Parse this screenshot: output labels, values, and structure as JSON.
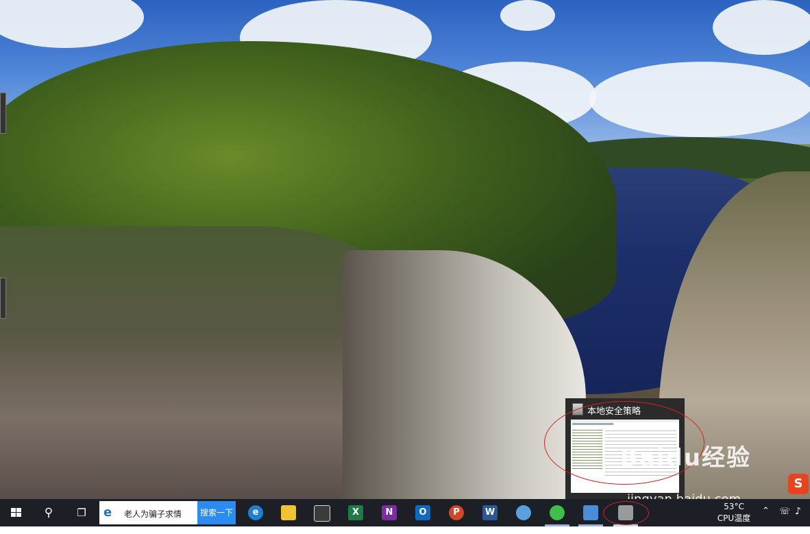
{
  "thumbnail": {
    "title": "本地安全策略"
  },
  "watermark": {
    "text": "Baidu经验",
    "url": "jingyan.baidu.com"
  },
  "taskbar": {
    "search": {
      "text": "老人为骗子求情",
      "button_label": "搜索一下"
    },
    "apps": [
      {
        "name": "edge",
        "label": "e",
        "color": "#1e7fd6"
      },
      {
        "name": "file-explorer",
        "label": "",
        "color": "#f2c232"
      },
      {
        "name": "store",
        "label": "",
        "color": "#3b3b3b"
      },
      {
        "name": "excel",
        "label": "X",
        "color": "#1f7a43"
      },
      {
        "name": "onenote",
        "label": "N",
        "color": "#7a2f9c"
      },
      {
        "name": "outlook",
        "label": "O",
        "color": "#0e6ac0"
      },
      {
        "name": "powerpoint",
        "label": "P",
        "color": "#d24726"
      },
      {
        "name": "word",
        "label": "W",
        "color": "#2b5797"
      },
      {
        "name": "paint",
        "label": "",
        "color": "#5aa0e0"
      },
      {
        "name": "green-app",
        "label": "",
        "color": "#3fbf4a"
      },
      {
        "name": "control-panel",
        "label": "",
        "color": "#4a8cd8"
      },
      {
        "name": "local-security-policy",
        "label": "",
        "color": "#9a9a9a"
      }
    ],
    "tray": {
      "temperature": "53°C",
      "temperature_label": "CPU温度"
    }
  },
  "colors": {
    "taskbar": "#1c1f26",
    "search_button": "#2a8cf0",
    "annotation": "#d62020"
  }
}
